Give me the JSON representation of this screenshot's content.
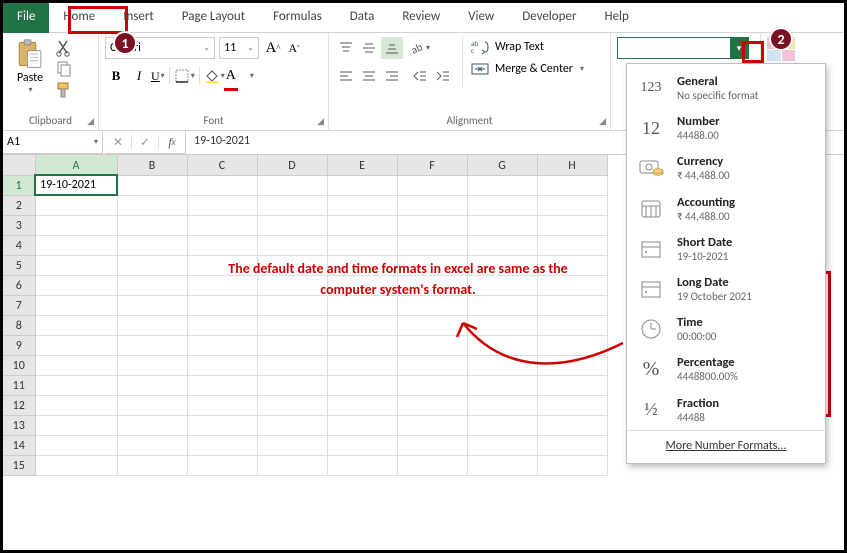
{
  "tabs": [
    "File",
    "Home",
    "Insert",
    "Page Layout",
    "Formulas",
    "Data",
    "Review",
    "View",
    "Developer",
    "Help"
  ],
  "ribbon": {
    "clipboard": {
      "paste_label": "Paste",
      "group_label": "Clipboard"
    },
    "font": {
      "name": "Calibri",
      "size": "11",
      "grow": "A",
      "shrink": "A",
      "bold": "B",
      "italic": "I",
      "underline": "U",
      "group_label": "Font"
    },
    "alignment": {
      "wrap_label": "Wrap Text",
      "merge_label": "Merge & Center",
      "group_label": "Alignment"
    }
  },
  "formula_bar": {
    "name_box": "A1",
    "formula": "19-10-2021"
  },
  "columns": [
    "A",
    "B",
    "C",
    "D",
    "E",
    "F",
    "G",
    "H"
  ],
  "rows": [
    "1",
    "2",
    "3",
    "4",
    "5",
    "6",
    "7",
    "8",
    "9",
    "10",
    "11",
    "12",
    "13",
    "14",
    "15"
  ],
  "cells": {
    "A1": "19-10-2021"
  },
  "format_dropdown": {
    "items": [
      {
        "name": "General",
        "value": "No specific format"
      },
      {
        "name": "Number",
        "value": "44488.00"
      },
      {
        "name": "Currency",
        "value": "₹ 44,488.00"
      },
      {
        "name": "Accounting",
        "value": "₹ 44,488.00"
      },
      {
        "name": "Short Date",
        "value": "19-10-2021"
      },
      {
        "name": "Long Date",
        "value": "19 October 2021"
      },
      {
        "name": "Time",
        "value": "00:00:00"
      },
      {
        "name": "Percentage",
        "value": "4448800.00%"
      },
      {
        "name": "Fraction",
        "value": "44488"
      }
    ],
    "more": "More Number Formats..."
  },
  "annotations": {
    "marker1": "1",
    "marker2": "2",
    "note": "The default date and time formats in excel are same as the computer system's format."
  }
}
